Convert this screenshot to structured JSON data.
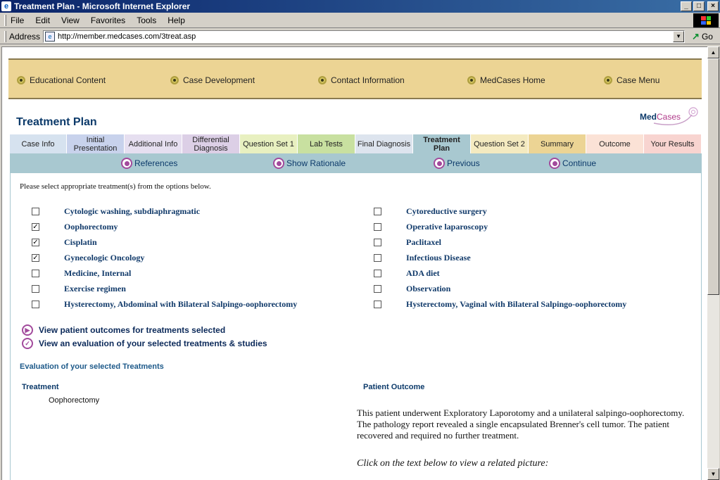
{
  "window": {
    "title": "Treatment Plan - Microsoft Internet Explorer",
    "buttons": [
      "_",
      "□",
      "×"
    ]
  },
  "menu": [
    "File",
    "Edit",
    "View",
    "Favorites",
    "Tools",
    "Help"
  ],
  "address": {
    "label": "Address",
    "url": "http://member.medcases.com/3treat.asp",
    "go": "Go"
  },
  "topnav": [
    "Educational Content",
    "Case Development",
    "Contact Information",
    "MedCases Home",
    "Case Menu"
  ],
  "page_title": "Treatment Plan",
  "logo": {
    "part1": "Med",
    "part2": "Cases"
  },
  "tabs": [
    {
      "label": "Case Info",
      "color": "#d6e2ef"
    },
    {
      "label": "Initial Presentation",
      "color": "#c8d2ec"
    },
    {
      "label": "Additional Info",
      "color": "#e6dff0"
    },
    {
      "label": "Differential Diagnosis",
      "color": "#dccfe6"
    },
    {
      "label": "Question Set 1",
      "color": "#e8f0c0"
    },
    {
      "label": "Lab Tests",
      "color": "#c8e0a0"
    },
    {
      "label": "Final Diagnosis",
      "color": "#dde4ee"
    },
    {
      "label": "Treatment Plan",
      "color": "#a8c8d0"
    },
    {
      "label": "Question Set 2",
      "color": "#f4eac0"
    },
    {
      "label": "Summary",
      "color": "#ecd494"
    },
    {
      "label": "Outcome",
      "color": "#fbe2d6"
    },
    {
      "label": "Your Results",
      "color": "#f8d4d0"
    }
  ],
  "subnav": [
    "References",
    "Show Rationale",
    "Previous",
    "Continue"
  ],
  "instruction": "Please select appropriate treatment(s) from the options below.",
  "treatments_left": [
    {
      "label": "Cytologic washing, subdiaphragmatic",
      "checked": false
    },
    {
      "label": "Oophorectomy",
      "checked": true
    },
    {
      "label": "Cisplatin",
      "checked": true
    },
    {
      "label": "Gynecologic Oncology",
      "checked": true
    },
    {
      "label": "Medicine, Internal",
      "checked": false
    },
    {
      "label": "Exercise regimen",
      "checked": false
    },
    {
      "label": "Hysterectomy, Abdominal with Bilateral Salpingo-oophorectomy",
      "checked": false
    }
  ],
  "treatments_right": [
    {
      "label": "Cytoreductive surgery",
      "checked": false
    },
    {
      "label": "Operative laparoscopy",
      "checked": false
    },
    {
      "label": "Paclitaxel",
      "checked": false
    },
    {
      "label": "Infectious Disease",
      "checked": false
    },
    {
      "label": "ADA diet",
      "checked": false
    },
    {
      "label": "Observation",
      "checked": false
    },
    {
      "label": "Hysterectomy, Vaginal with Bilateral Salpingo-oophorectomy",
      "checked": false
    }
  ],
  "actions": {
    "view_outcomes": "View patient outcomes for treatments selected",
    "view_evaluation": "View an evaluation of your selected treatments & studies"
  },
  "evaluation": {
    "title": "Evaluation of your selected Treatments",
    "col_treatment": "Treatment",
    "col_outcome": "Patient Outcome",
    "treatment": "Oophorectomy",
    "outcome": "This patient underwent Exploratory Laporotomy and a unilateral salpingo-oophorectomy. The pathology report revealed a single encapsulated Brenner's cell tumor. The patient recovered and required no further treatment.",
    "click_note": "Click on the text below to view a related picture:"
  }
}
